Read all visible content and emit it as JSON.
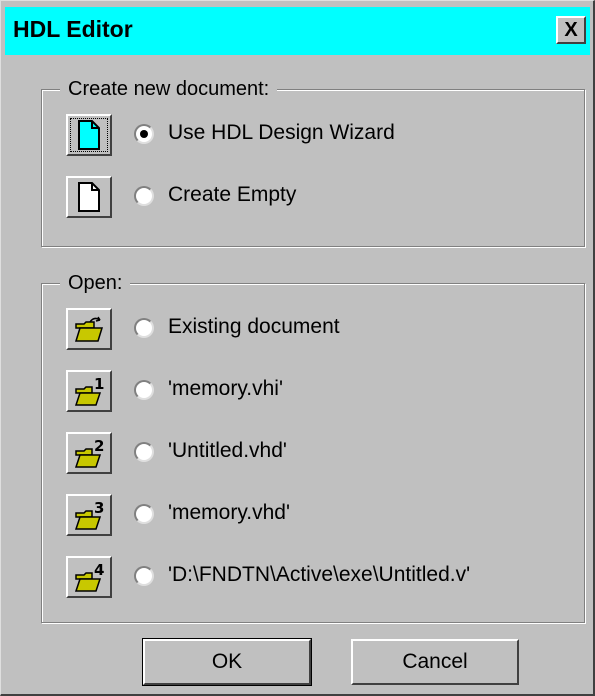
{
  "window": {
    "title": "HDL Editor",
    "close_label": "X"
  },
  "create_group": {
    "legend": "Create new document:",
    "items": [
      {
        "label": "Use HDL Design Wizard",
        "icon": "wizard-document-icon",
        "selected": true
      },
      {
        "label": "Create Empty",
        "icon": "blank-document-icon",
        "selected": false
      }
    ]
  },
  "open_group": {
    "legend": "Open:",
    "items": [
      {
        "label": "Existing document",
        "icon": "open-folder-icon",
        "badge": ""
      },
      {
        "label": "'memory.vhi'",
        "icon": "recent-file-folder-icon",
        "badge": "1"
      },
      {
        "label": "'Untitled.vhd'",
        "icon": "recent-file-folder-icon",
        "badge": "2"
      },
      {
        "label": "'memory.vhd'",
        "icon": "recent-file-folder-icon",
        "badge": "3"
      },
      {
        "label": "'D:\\FNDTN\\Active\\exe\\Untitled.v'",
        "icon": "recent-file-folder-icon",
        "badge": "4"
      }
    ]
  },
  "buttons": {
    "ok_label": "OK",
    "cancel_label": "Cancel"
  },
  "colors": {
    "titlebar": "#00ffff",
    "face": "#c0c0c0",
    "folder": "#c8c800",
    "wizard_doc": "#00ffff"
  }
}
